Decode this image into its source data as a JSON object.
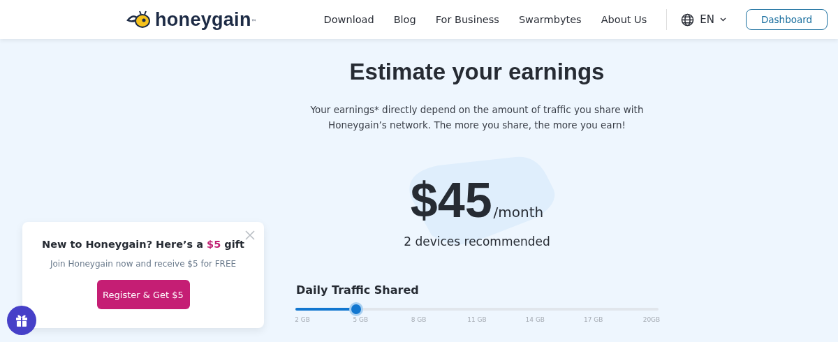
{
  "header": {
    "logo": {
      "text": "honeygain",
      "mark": "™"
    },
    "nav": [
      "Download",
      "Blog",
      "For Business",
      "Swarmbytes",
      "About Us"
    ],
    "language": "EN",
    "dashboard": "Dashboard"
  },
  "main": {
    "title": "Estimate your earnings",
    "intro": "Your earnings* directly depend on the amount of traffic you share with Honeygain’s network. The more you share, the more you earn!",
    "price": "$45",
    "period": "/month",
    "devices": "2 devices recommended",
    "slider": {
      "label": "Daily Traffic Shared",
      "level": 0.167,
      "ticks": [
        "2 GB",
        "5 GB",
        "8 GB",
        "11 GB",
        "14 GB",
        "17 GB",
        "20GB"
      ]
    }
  },
  "popup": {
    "title": "New to Honeygain? Here’s a **$5** gift",
    "text": "Join Honeygain now and receive $5 for FREE",
    "button": "Register & Get $5"
  }
}
